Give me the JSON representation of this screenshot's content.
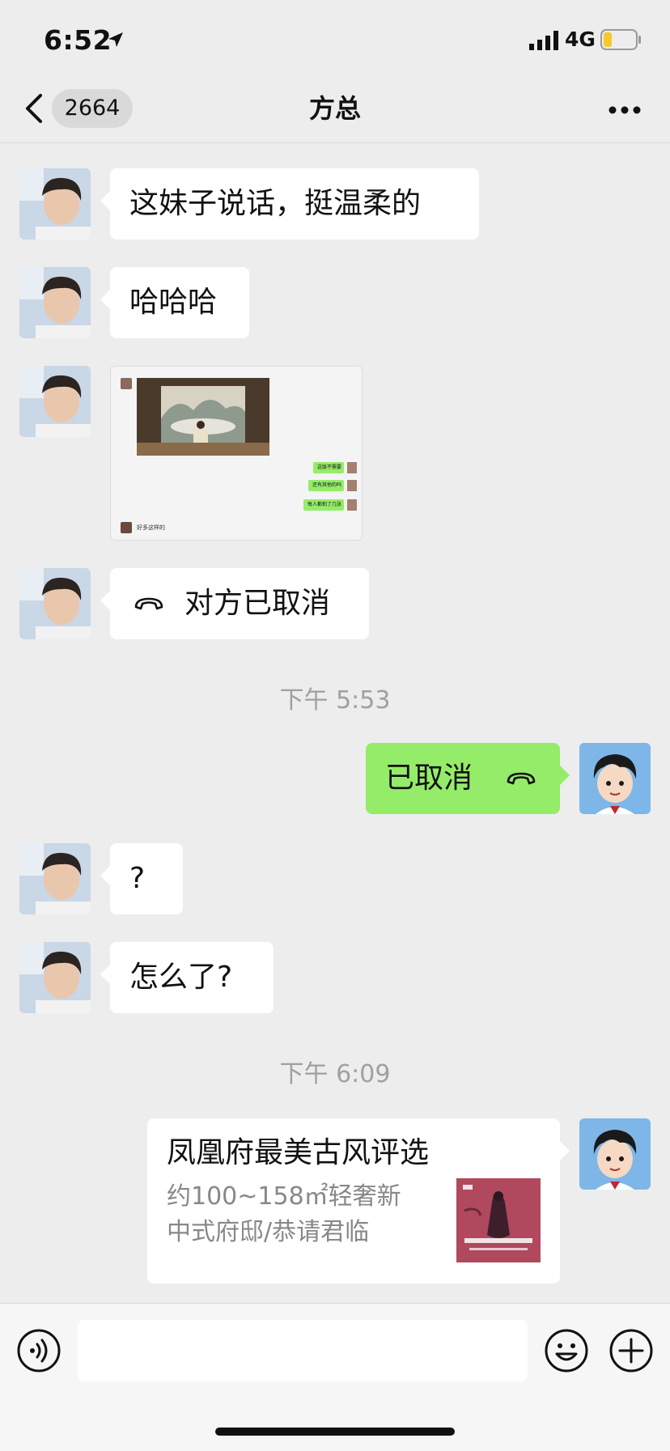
{
  "status": {
    "time": "6:52",
    "network": "4G"
  },
  "nav": {
    "back_count": "2664",
    "title": "方总"
  },
  "messages": [
    {
      "text": "这妹子说话，挺温柔的"
    },
    {
      "text": "哈哈哈"
    },
    {
      "screenshot": {
        "replies": [
          "这版不需要",
          "还有其他的吗",
          "每人都拍了几张"
        ],
        "caption": "好多这样的"
      }
    },
    {
      "call": "对方已取消"
    },
    {
      "timestamp": "下午 5:53"
    },
    {
      "call_out": "已取消"
    },
    {
      "text": "?"
    },
    {
      "text": "怎么了?"
    },
    {
      "timestamp": "下午 6:09"
    },
    {
      "card": {
        "title": "凤凰府最美古风评选",
        "desc_line1": "约100~158㎡轻奢新",
        "desc_line2": "中式府邸/恭请君临"
      }
    }
  ],
  "colors": {
    "sent_bubble": "#95ec69",
    "received_bubble": "#ffffff",
    "background": "#ededed",
    "card_thumb": "#b0485e"
  },
  "icons": [
    "location-arrow-icon",
    "signal-icon",
    "battery-icon",
    "back-icon",
    "more-icon",
    "phone-hangup-icon",
    "voice-icon",
    "emoji-icon",
    "plus-icon"
  ]
}
